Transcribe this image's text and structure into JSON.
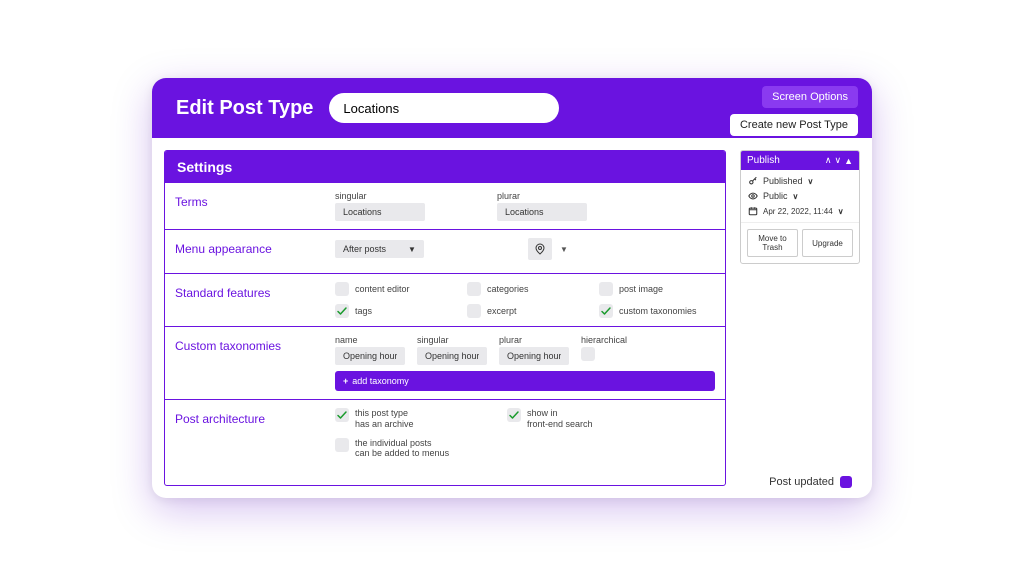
{
  "header": {
    "title": "Edit Post Type",
    "name_value": "Locations",
    "screen_options": "Screen Options",
    "create_new": "Create new Post Type"
  },
  "settings": {
    "title": "Settings",
    "terms": {
      "label": "Terms",
      "singular_label": "singular",
      "singular_value": "Locations",
      "plural_label": "plurar",
      "plural_value": "Locations"
    },
    "menu": {
      "label": "Menu appearance",
      "position_value": "After posts"
    },
    "features": {
      "label": "Standard features",
      "items": [
        {
          "label": "content editor",
          "checked": false
        },
        {
          "label": "categories",
          "checked": false
        },
        {
          "label": "post image",
          "checked": false
        },
        {
          "label": "tags",
          "checked": true
        },
        {
          "label": "excerpt",
          "checked": false
        },
        {
          "label": "custom taxonomies",
          "checked": true
        }
      ]
    },
    "taxonomies": {
      "label": "Custom taxonomies",
      "cols": {
        "name": "name",
        "singular": "singular",
        "plural": "plurar",
        "hier": "hierarchical"
      },
      "row": {
        "name": "Opening hours",
        "singular": "Opening hours",
        "plural": "Opening hours"
      },
      "add_label": "add taxonomy"
    },
    "arch": {
      "label": "Post architecture",
      "items": [
        {
          "label": "this post type\nhas an archive",
          "checked": true
        },
        {
          "label": "show in\nfront-end search",
          "checked": true
        },
        {
          "label": "the individual posts\ncan be added to menus",
          "checked": false
        }
      ]
    }
  },
  "publish": {
    "title": "Publish",
    "status": "Published",
    "visibility": "Public",
    "date": "Apr 22, 2022, 11:44",
    "trash": "Move to Trash",
    "upgrade": "Upgrade"
  },
  "footer": {
    "msg": "Post updated"
  }
}
